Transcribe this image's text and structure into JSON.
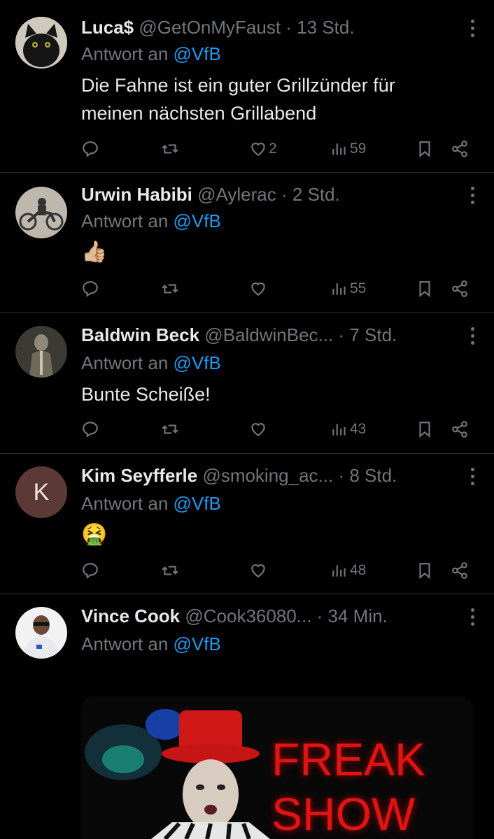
{
  "tweets": [
    {
      "name": "Luca$",
      "handle": "@GetOnMyFaust",
      "time": "· 13 Std.",
      "reply_prefix": "Antwort an",
      "reply_to": "@VfB",
      "text_lines": [
        "Die Fahne ist ein guter Grillzünder für",
        "meinen nächsten Grillabend"
      ],
      "likes": "2",
      "views": "59",
      "avatar": "black-cat-avatar"
    },
    {
      "name": "Urwin Habibi",
      "handle": "@Aylerac",
      "time": "· 2 Std.",
      "reply_prefix": "Antwort an",
      "reply_to": "@VfB",
      "text": "👍🏼",
      "likes": "",
      "views": "55",
      "avatar": "motorcycle-avatar"
    },
    {
      "name": "Baldwin Beck",
      "handle": "@BaldwinBec...",
      "time": "· 7 Std.",
      "reply_prefix": "Antwort an",
      "reply_to": "@VfB",
      "text": "Bunte Scheiße!",
      "likes": "",
      "views": "43",
      "avatar": "knight-avatar"
    },
    {
      "name": "Kim Seyfferle",
      "handle": "@smoking_ac...",
      "time": "· 8 Std.",
      "reply_prefix": "Antwort an",
      "reply_to": "@VfB",
      "text": "🤮",
      "likes": "",
      "views": "48",
      "avatar_letter": "K",
      "avatar_color": "#5b3a35"
    },
    {
      "name": "Vince Cook",
      "handle": "@Cook36080...",
      "time": "· 34 Min.",
      "reply_prefix": "Antwort an",
      "reply_to": "@VfB",
      "media_text_1": "FREAK",
      "media_text_2": "SHOW",
      "avatar": "man-portrait-avatar"
    }
  ],
  "colors": {
    "accent": "#1d9bf0",
    "muted": "#71767b",
    "divider": "#2f3336",
    "freak_red": "#e01414"
  }
}
